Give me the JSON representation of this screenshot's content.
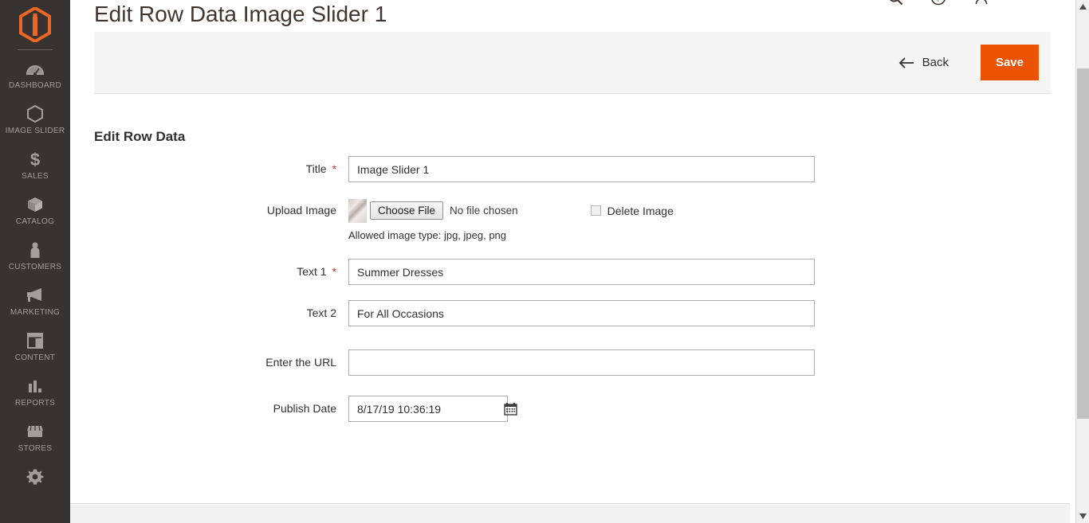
{
  "sidebar": {
    "logo": "magento-logo",
    "items": [
      {
        "label": "DASHBOARD",
        "icon": "dashboard-icon"
      },
      {
        "label": "IMAGE SLIDER",
        "icon": "hexagon-icon"
      },
      {
        "label": "SALES",
        "icon": "dollar-icon"
      },
      {
        "label": "CATALOG",
        "icon": "box-icon"
      },
      {
        "label": "CUSTOMERS",
        "icon": "person-icon"
      },
      {
        "label": "MARKETING",
        "icon": "megaphone-icon"
      },
      {
        "label": "CONTENT",
        "icon": "layout-icon"
      },
      {
        "label": "REPORTS",
        "icon": "bar-chart-icon"
      },
      {
        "label": "STORES",
        "icon": "storefront-icon"
      },
      {
        "label": "",
        "icon": "gear-icon"
      }
    ]
  },
  "header": {
    "page_title": "Edit Row Data Image Slider 1",
    "icons": [
      "search-icon",
      "help-icon",
      "account-icon"
    ]
  },
  "toolbar": {
    "back_label": "Back",
    "save_label": "Save",
    "back_icon": "arrow-left-icon",
    "accent_color": "#eb5202"
  },
  "section": {
    "title": "Edit Row Data"
  },
  "form": {
    "title": {
      "label": "Title",
      "required": "*",
      "value": "Image Slider 1",
      "placeholder": ""
    },
    "upload_image": {
      "label": "Upload Image",
      "choose_file_label": "Choose File",
      "no_file_text": "No file chosen",
      "delete_label": "Delete Image",
      "delete_checked": false,
      "note": "Allowed image type: jpg, jpeg, png",
      "thumbnail_icon": "image-thumbnail"
    },
    "text1": {
      "label": "Text 1",
      "required": "*",
      "value": "Summer Dresses",
      "placeholder": ""
    },
    "text2": {
      "label": "Text 2",
      "required": "",
      "value": "For All Occasions",
      "placeholder": ""
    },
    "url": {
      "label": "Enter the URL",
      "required": "",
      "value": "",
      "placeholder": ""
    },
    "publish_date": {
      "label": "Publish Date",
      "required": "",
      "value": "8/17/19 10:36:19",
      "placeholder": "",
      "calendar_icon": "calendar-icon"
    }
  },
  "scrollbar": {
    "up_icon": "caret-up-icon",
    "down_icon": "caret-down-icon"
  }
}
